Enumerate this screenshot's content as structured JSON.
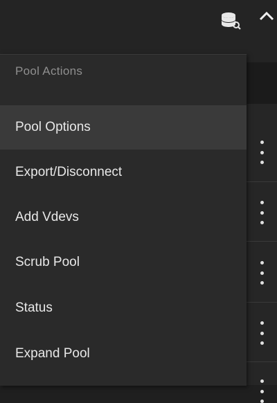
{
  "menu": {
    "header": "Pool Actions",
    "items": [
      {
        "label": "Pool Options",
        "active": true
      },
      {
        "label": "Export/Disconnect",
        "active": false
      },
      {
        "label": "Add Vdevs",
        "active": false
      },
      {
        "label": "Scrub Pool",
        "active": false
      },
      {
        "label": "Status",
        "active": false
      },
      {
        "label": "Expand Pool",
        "active": false
      }
    ]
  },
  "icons": {
    "pool": "database-icon",
    "collapse": "chevron-up-icon",
    "row_actions": "more-vert-icon"
  }
}
